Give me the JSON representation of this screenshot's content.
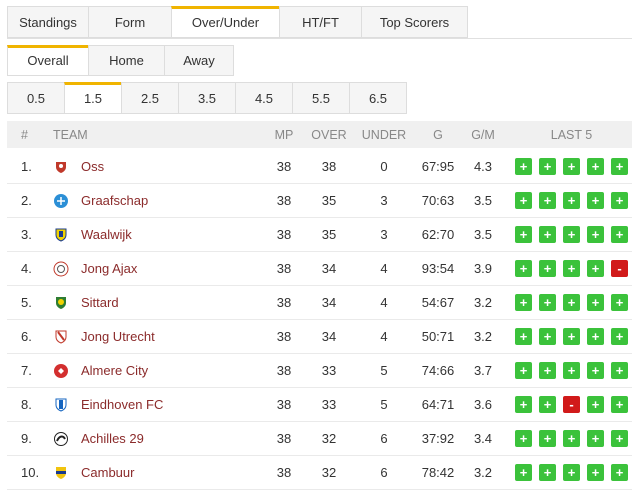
{
  "tabs_main": [
    "Standings",
    "Form",
    "Over/Under",
    "HT/FT",
    "Top Scorers"
  ],
  "tabs_main_active": 2,
  "tabs_venue": [
    "Overall",
    "Home",
    "Away"
  ],
  "tabs_venue_active": 0,
  "tabs_lines": [
    "0.5",
    "1.5",
    "2.5",
    "3.5",
    "4.5",
    "5.5",
    "6.5"
  ],
  "tabs_lines_active": 1,
  "columns": {
    "pos": "#",
    "team": "TEAM",
    "mp": "MP",
    "over": "OVER",
    "under": "UNDER",
    "g": "G",
    "gm": "G/M",
    "last5": "LAST 5"
  },
  "colors": {
    "win": "#3bc23b",
    "loss": "#d11a1a",
    "accent": "#f0b400",
    "team_link": "#8b2b2b"
  },
  "rows": [
    {
      "pos": "1.",
      "team": "Oss",
      "logo": "oss-logo",
      "mp": "38",
      "over": "38",
      "under": "0",
      "g": "67:95",
      "gm": "4.3",
      "last5": [
        "+",
        "+",
        "+",
        "+",
        "+"
      ]
    },
    {
      "pos": "2.",
      "team": "Graafschap",
      "logo": "graafschap-logo",
      "mp": "38",
      "over": "35",
      "under": "3",
      "g": "70:63",
      "gm": "3.5",
      "last5": [
        "+",
        "+",
        "+",
        "+",
        "+"
      ]
    },
    {
      "pos": "3.",
      "team": "Waalwijk",
      "logo": "waalwijk-logo",
      "mp": "38",
      "over": "35",
      "under": "3",
      "g": "62:70",
      "gm": "3.5",
      "last5": [
        "+",
        "+",
        "+",
        "+",
        "+"
      ]
    },
    {
      "pos": "4.",
      "team": "Jong Ajax",
      "logo": "ajax-logo",
      "mp": "38",
      "over": "34",
      "under": "4",
      "g": "93:54",
      "gm": "3.9",
      "last5": [
        "+",
        "+",
        "+",
        "+",
        "-"
      ]
    },
    {
      "pos": "5.",
      "team": "Sittard",
      "logo": "sittard-logo",
      "mp": "38",
      "over": "34",
      "under": "4",
      "g": "54:67",
      "gm": "3.2",
      "last5": [
        "+",
        "+",
        "+",
        "+",
        "+"
      ]
    },
    {
      "pos": "6.",
      "team": "Jong Utrecht",
      "logo": "utrecht-logo",
      "mp": "38",
      "over": "34",
      "under": "4",
      "g": "50:71",
      "gm": "3.2",
      "last5": [
        "+",
        "+",
        "+",
        "+",
        "+"
      ]
    },
    {
      "pos": "7.",
      "team": "Almere City",
      "logo": "almere-logo",
      "mp": "38",
      "over": "33",
      "under": "5",
      "g": "74:66",
      "gm": "3.7",
      "last5": [
        "+",
        "+",
        "+",
        "+",
        "+"
      ]
    },
    {
      "pos": "8.",
      "team": "Eindhoven FC",
      "logo": "eindhoven-logo",
      "mp": "38",
      "over": "33",
      "under": "5",
      "g": "64:71",
      "gm": "3.6",
      "last5": [
        "+",
        "+",
        "-",
        "+",
        "+"
      ]
    },
    {
      "pos": "9.",
      "team": "Achilles 29",
      "logo": "achilles-logo",
      "mp": "38",
      "over": "32",
      "under": "6",
      "g": "37:92",
      "gm": "3.4",
      "last5": [
        "+",
        "+",
        "+",
        "+",
        "+"
      ]
    },
    {
      "pos": "10.",
      "team": "Cambuur",
      "logo": "cambuur-logo",
      "mp": "38",
      "over": "32",
      "under": "6",
      "g": "78:42",
      "gm": "3.2",
      "last5": [
        "+",
        "+",
        "+",
        "+",
        "+"
      ]
    }
  ]
}
